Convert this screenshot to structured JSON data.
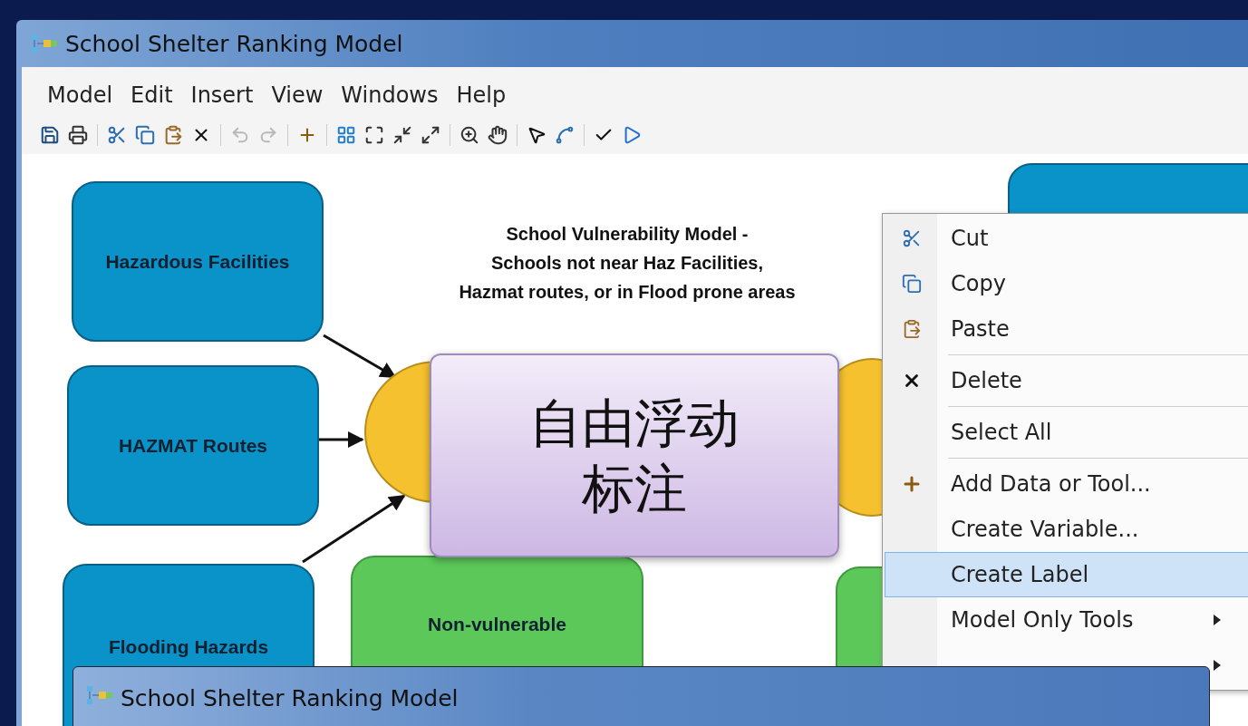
{
  "window": {
    "title": "School Shelter Ranking Model"
  },
  "menu": [
    {
      "label": "Model"
    },
    {
      "label": "Edit"
    },
    {
      "label": "Insert"
    },
    {
      "label": "View"
    },
    {
      "label": "Windows"
    },
    {
      "label": "Help"
    }
  ],
  "toolbar": [
    {
      "kind": "save",
      "disabled": false
    },
    {
      "kind": "print",
      "disabled": false
    },
    {
      "kind": "separator"
    },
    {
      "kind": "cut",
      "disabled": false
    },
    {
      "kind": "copy",
      "disabled": false
    },
    {
      "kind": "paste",
      "disabled": false
    },
    {
      "kind": "delete",
      "disabled": false
    },
    {
      "kind": "separator"
    },
    {
      "kind": "undo",
      "disabled": true
    },
    {
      "kind": "redo",
      "disabled": true
    },
    {
      "kind": "separator"
    },
    {
      "kind": "add",
      "disabled": false
    },
    {
      "kind": "separator"
    },
    {
      "kind": "layout",
      "disabled": false
    },
    {
      "kind": "full-extent",
      "disabled": false
    },
    {
      "kind": "zoom-in-fixed",
      "disabled": false
    },
    {
      "kind": "zoom-out-fixed",
      "disabled": false
    },
    {
      "kind": "separator"
    },
    {
      "kind": "zoom",
      "disabled": false
    },
    {
      "kind": "pan",
      "disabled": false
    },
    {
      "kind": "separator"
    },
    {
      "kind": "select",
      "disabled": false
    },
    {
      "kind": "connect",
      "disabled": false
    },
    {
      "kind": "separator"
    },
    {
      "kind": "validate",
      "disabled": false
    },
    {
      "kind": "run",
      "disabled": false
    }
  ],
  "diagram": {
    "title_lines": [
      "School Vulnerability Model -",
      "Schools not near Haz Facilities,",
      "Hazmat routes, or in Flood prone areas"
    ],
    "nodes": [
      {
        "kind": "data",
        "label": "Hazardous Facilities"
      },
      {
        "kind": "data",
        "label": "HAZMAT Routes"
      },
      {
        "kind": "data",
        "label": "Flooding Hazards"
      },
      {
        "kind": "data"
      },
      {
        "kind": "tool"
      },
      {
        "kind": "tool"
      },
      {
        "kind": "output",
        "label": "Non-vulnerable"
      },
      {
        "kind": "output"
      }
    ],
    "floating_label": {
      "lines": [
        "自由浮动",
        "标注"
      ]
    }
  },
  "context_menu": {
    "items": [
      {
        "kind": "cut",
        "label": "Cut",
        "selected": false
      },
      {
        "kind": "copy",
        "label": "Copy",
        "selected": false
      },
      {
        "kind": "paste",
        "label": "Paste",
        "selected": false
      },
      {
        "kind": "separator"
      },
      {
        "kind": "delete",
        "label": "Delete",
        "selected": false
      },
      {
        "kind": "separator"
      },
      {
        "kind": "plain",
        "label": "Select All",
        "selected": false
      },
      {
        "kind": "separator"
      },
      {
        "kind": "add",
        "label": "Add Data or Tool...",
        "selected": false
      },
      {
        "kind": "plain",
        "label": "Create Variable...",
        "selected": false
      },
      {
        "kind": "plain",
        "label": "Create Label",
        "selected": true
      },
      {
        "kind": "submenu",
        "label": "Model Only Tools",
        "selected": false
      },
      {
        "kind": "submenu",
        "selected": false
      }
    ]
  },
  "second_window": {
    "title": "School Shelter Ranking Model"
  }
}
